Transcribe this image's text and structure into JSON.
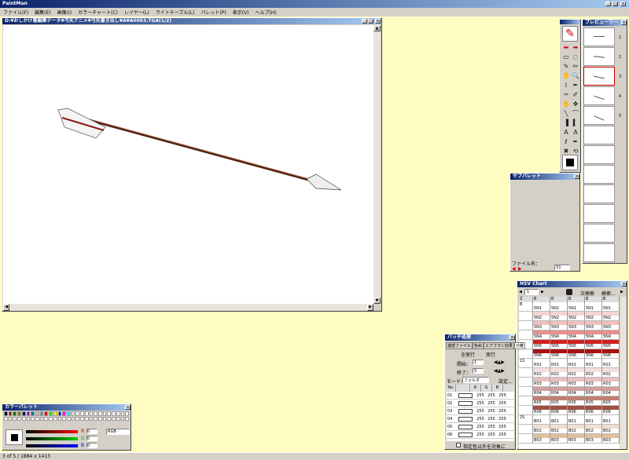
{
  "app": {
    "title": "PaintMan",
    "status": "3 of 5 / 1884 x 1413"
  },
  "menu": [
    "ファイル(F)",
    "編集(E)",
    "画像(I)",
    "カラーチャート(C)",
    "レイヤー(L)",
    "ライトテーブル(L)",
    "パレット(P)",
    "表示(V)",
    "ヘルプ(H)"
  ],
  "canvas": {
    "title": "D:¥おしかけ書編集データ¥弓矢アニメ¥弓矢書き出し¥A¥A0003.TGA(1/2)"
  },
  "preview": {
    "title": "プレビューワー",
    "frames": [
      "1",
      "2",
      "3",
      "4",
      "5"
    ]
  },
  "subpalette": {
    "title": "サブパレット",
    "filename_label": "ファイル名：",
    "zoom": "X1"
  },
  "hsv": {
    "title": "HSV Chart",
    "page": "1",
    "next_search": "次検索",
    "search": "検索...",
    "col_headers": [
      "Z",
      "B",
      "B",
      "B",
      "B",
      "B"
    ],
    "rows": [
      {
        "z": "B",
        "cells": [
          "5N1",
          "5N1",
          "5N1",
          "5N1",
          "5N1"
        ]
      },
      {
        "z": "",
        "cells": [
          "5N2",
          "5N2",
          "5N2",
          "5N2",
          "5N2"
        ]
      },
      {
        "z": "",
        "cells": [
          "5N3",
          "5N3",
          "5N3",
          "5N3",
          "5N3"
        ]
      },
      {
        "z": "",
        "cells": [
          "5N4",
          "5N4",
          "5N4",
          "5N4",
          "5N4"
        ]
      },
      {
        "z": "",
        "cells": [
          "5N5",
          "5N5",
          "5N5",
          "5N5",
          "5N5"
        ]
      },
      {
        "z": "",
        "cells": [
          "5N6",
          "5N6",
          "5N6",
          "5N6",
          "5N6"
        ]
      },
      {
        "z": "1S",
        "cells": [
          "R01",
          "R01",
          "R01",
          "R01",
          "R01"
        ]
      },
      {
        "z": "",
        "cells": [
          "R02",
          "R02",
          "R02",
          "R02",
          "R02"
        ]
      },
      {
        "z": "",
        "cells": [
          "R03",
          "R03",
          "R03",
          "R03",
          "R03"
        ]
      },
      {
        "z": "",
        "cells": [
          "R04",
          "R04",
          "R04",
          "R04",
          "R04"
        ]
      },
      {
        "z": "",
        "cells": [
          "R05",
          "R05",
          "R05",
          "R05",
          "R05"
        ]
      },
      {
        "z": "",
        "cells": [
          "R06",
          "R06",
          "R06",
          "R06",
          "R06"
        ]
      },
      {
        "z": "2S",
        "cells": [
          "B01",
          "B01",
          "B01",
          "B01",
          "B01"
        ]
      },
      {
        "z": "",
        "cells": [
          "B02",
          "B02",
          "B02",
          "B02",
          "B02"
        ]
      },
      {
        "z": "",
        "cells": [
          "B03",
          "B03",
          "B03",
          "B03",
          "B03"
        ]
      }
    ]
  },
  "batch": {
    "title": "バッチ処理",
    "tabs": [
      "連続ファイル",
      "色ぬ",
      "エアブラシ効果",
      "分離"
    ],
    "all_run": "全実行",
    "run": "実行",
    "start_label": "開始：",
    "start_val": "1",
    "end_label": "終了：",
    "end_val": "5",
    "mode_label": "モード：",
    "mode_val": "フォルダ",
    "settings": "設定...",
    "headers": [
      "No.",
      "",
      "R",
      "G",
      "B"
    ],
    "rows": [
      [
        "01",
        "255",
        "255",
        "255"
      ],
      [
        "02",
        "255",
        "255",
        "255"
      ],
      [
        "03",
        "255",
        "255",
        "255"
      ],
      [
        "04",
        "255",
        "255",
        "255"
      ],
      [
        "05",
        "255",
        "255",
        "255"
      ],
      [
        "06",
        "255",
        "255",
        "255"
      ]
    ],
    "check_label": "指定色以外を対象に"
  },
  "colorpal": {
    "title": "カラーパレット",
    "r_label": "R",
    "r_val": "0",
    "g_label": "G",
    "g_val": "0",
    "b_label": "B",
    "b_val": "0",
    "mode": "RGB"
  },
  "colors": {
    "title_active": "#0a246a",
    "bg": "#fefcc0",
    "red": "#cc0000",
    "darkred": "#8a1a10",
    "brown": "#9a5030"
  }
}
